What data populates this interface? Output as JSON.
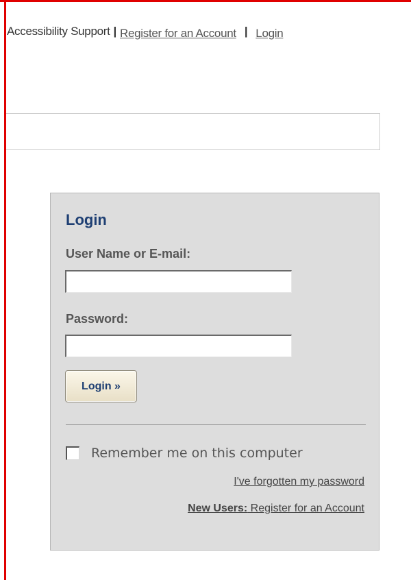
{
  "header": {
    "accessibility_text": "Accessibility Support",
    "separator": "|",
    "register_link": "Register for an Account",
    "login_link": "Login"
  },
  "login_box": {
    "title": "Login",
    "username_label": "User Name or E-mail:",
    "username_value": "",
    "password_label": "Password:",
    "password_value": "",
    "submit_label": "Login »",
    "remember_checked": false,
    "remember_label": "Remember me on this computer",
    "forgot_link": "I've forgotten my password",
    "new_users_prefix": "New Users:",
    "new_users_link": " Register for an Account"
  },
  "colors": {
    "frame_red": "#e00000",
    "title_blue": "#1e3f73",
    "panel_gray": "#dddddd"
  }
}
